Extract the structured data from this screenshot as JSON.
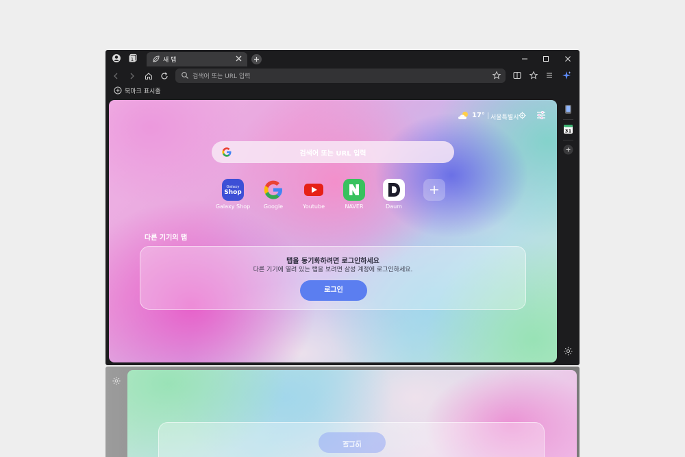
{
  "titlebar": {
    "tab_title": "새 탭"
  },
  "toolbar": {
    "url_placeholder": "검색어 또는 URL 입력"
  },
  "bookmarks": {
    "show_label": "북마크 표시줄"
  },
  "page": {
    "weather": {
      "temperature": "17°",
      "city": "서울특별시"
    },
    "search_placeholder": "검색어 또는 URL 입력",
    "shortcuts": [
      {
        "label": "Galaxy Shop",
        "color": "#3d4fd6"
      },
      {
        "label": "Google",
        "color": "#ffffff"
      },
      {
        "label": "Youtube",
        "color": "#ff0000"
      },
      {
        "label": "NAVER",
        "color": "#03c75a"
      },
      {
        "label": "Daum",
        "color": "#ffffff"
      }
    ],
    "galaxy_shop_logo": {
      "line1": "Galaxy",
      "line2": "Shop"
    },
    "other_devices_title": "다른 기기의 탭",
    "sync_card": {
      "title": "탭을 동기화하려면 로그인하세요",
      "description": "다른 기기에 열려 있는 탭을 보려면 삼성 계정에 로그인하세요.",
      "login_button": "로그인"
    }
  },
  "side_panel": {
    "calendar_day": "31"
  },
  "second_window": {
    "login_button": "로그인"
  },
  "colors": {
    "accent": "#5b7ef0",
    "window_bg": "#1c1c1e",
    "toolbar_field": "#333335"
  }
}
